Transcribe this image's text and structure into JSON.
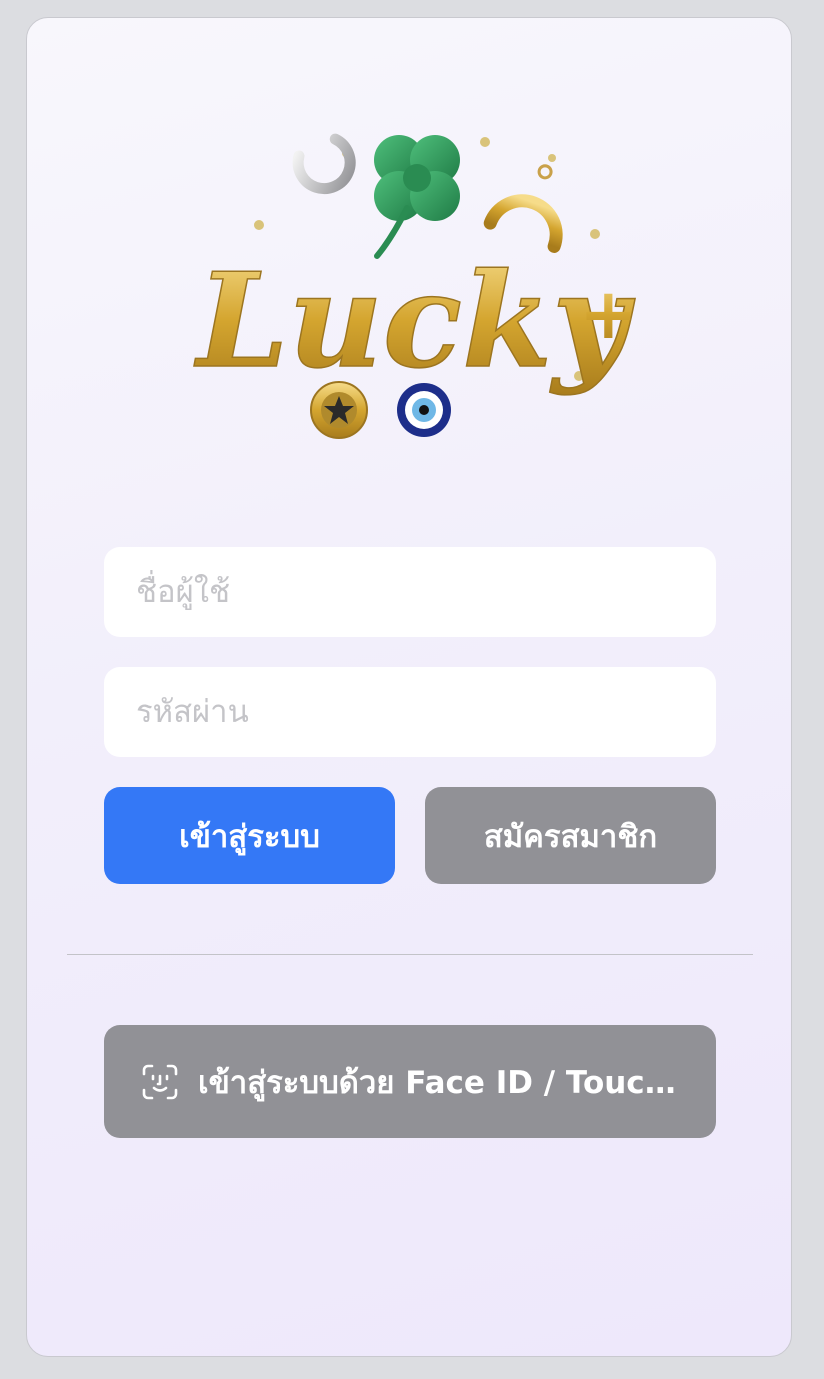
{
  "logo": {
    "text": "Lucky",
    "plus": "+"
  },
  "form": {
    "username_placeholder": "ชื่อผู้ใช้",
    "password_placeholder": "รหัสผ่าน",
    "username_value": "",
    "password_value": ""
  },
  "buttons": {
    "login_label": "เข้าสู่ระบบ",
    "register_label": "สมัครสมาชิก",
    "biometric_label": "เข้าสู่ระบบด้วย Face ID / Touch..."
  },
  "icons": {
    "biometric": "face-id-icon"
  },
  "colors": {
    "primary": "#3478f6",
    "secondary": "#919196",
    "gold": "#d4a52f",
    "clover": "#2e9a5a"
  }
}
